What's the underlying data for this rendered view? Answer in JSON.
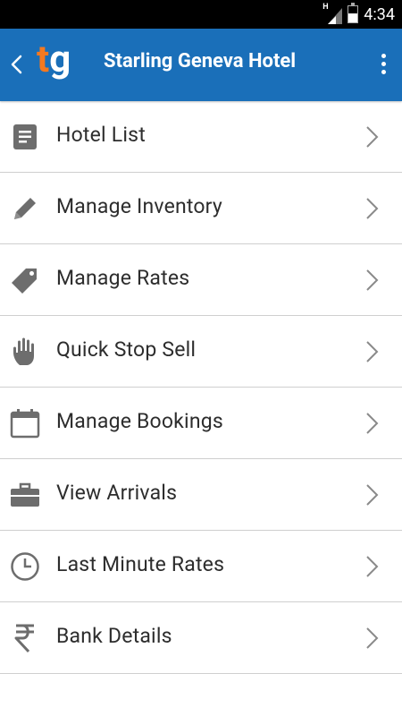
{
  "status_bar": {
    "network": "H",
    "time": "4:34"
  },
  "app_bar": {
    "logo_t": "t",
    "logo_g": "g",
    "title": "Starling Geneva Hotel",
    "colors": {
      "background": "#1a6fb9",
      "logo_accent": "#f47920"
    }
  },
  "menu": {
    "items": [
      {
        "label": "Hotel List",
        "icon": "list-icon"
      },
      {
        "label": "Manage Inventory",
        "icon": "pencil-icon"
      },
      {
        "label": "Manage Rates",
        "icon": "tag-icon"
      },
      {
        "label": "Quick Stop Sell",
        "icon": "hand-icon"
      },
      {
        "label": "Manage Bookings",
        "icon": "calendar-icon"
      },
      {
        "label": "View Arrivals",
        "icon": "briefcase-icon"
      },
      {
        "label": "Last Minute Rates",
        "icon": "clock-icon"
      },
      {
        "label": "Bank Details",
        "icon": "rupee-icon"
      }
    ]
  }
}
